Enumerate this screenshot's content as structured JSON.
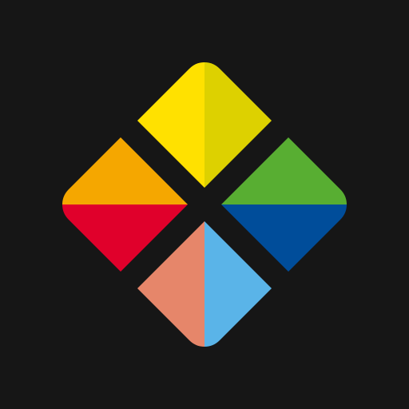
{
  "logo": {
    "name": "four-diamond-app-logo",
    "background_color": "#161616",
    "tiles": [
      {
        "name": "top-diamond",
        "colors": {
          "left": "#FFE100",
          "right": "#DDD100"
        }
      },
      {
        "name": "left-diamond",
        "colors": {
          "top": "#F5A700",
          "bottom": "#E0002B"
        }
      },
      {
        "name": "right-diamond",
        "colors": {
          "top": "#58AE32",
          "bottom": "#004D9A"
        }
      },
      {
        "name": "bottom-diamond",
        "colors": {
          "left": "#E6866A",
          "right": "#5AB4E8"
        }
      }
    ]
  }
}
